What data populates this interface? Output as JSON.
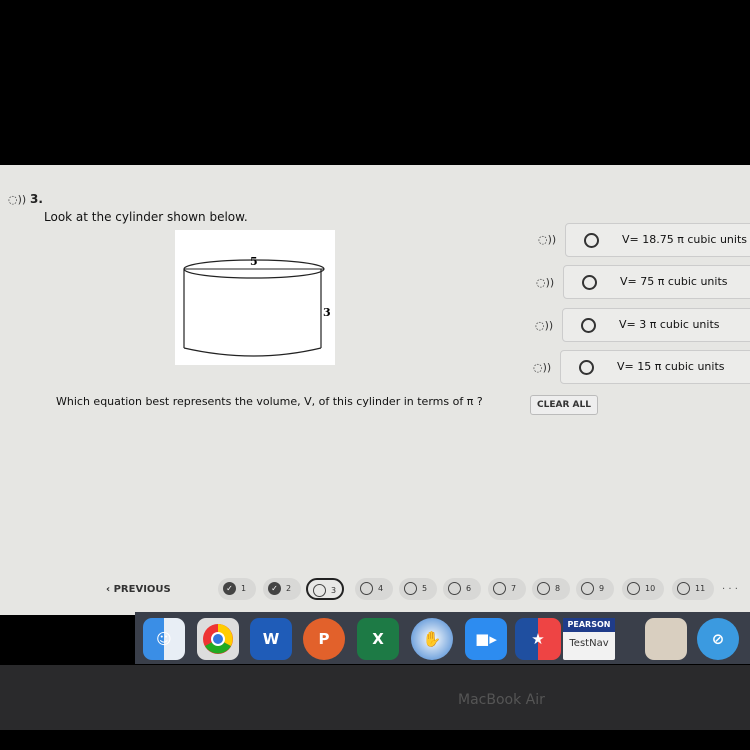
{
  "question": {
    "number": "3.",
    "prompt": "Look at the cylinder shown below.",
    "figure": {
      "diameter_label": "5",
      "height_label": "3"
    },
    "text": "Which equation best represents the volume, V, of this cylinder in terms of π ?"
  },
  "options": [
    {
      "label": "V= 18.75 π  cubic units"
    },
    {
      "label": "V= 75 π cubic units"
    },
    {
      "label": "V= 3 π cubic units"
    },
    {
      "label": "V= 15 π cubic units"
    }
  ],
  "clear_all": "CLEAR ALL",
  "nav": {
    "previous": "‹  PREVIOUS",
    "pages": [
      {
        "n": "1",
        "state": "answered"
      },
      {
        "n": "2",
        "state": "answered"
      },
      {
        "n": "3",
        "state": "current"
      },
      {
        "n": "4"
      },
      {
        "n": "5"
      },
      {
        "n": "6"
      },
      {
        "n": "7"
      },
      {
        "n": "8"
      },
      {
        "n": "9"
      },
      {
        "n": "10"
      },
      {
        "n": "11"
      }
    ],
    "more": "· · ·"
  },
  "dock": [
    {
      "name": "Finder"
    },
    {
      "name": "Chrome"
    },
    {
      "name": "Word",
      "letter": "W"
    },
    {
      "name": "PowerPoint",
      "letter": "P"
    },
    {
      "name": "Excel",
      "letter": "X"
    },
    {
      "name": "App"
    },
    {
      "name": "Zoom"
    },
    {
      "name": "Texas"
    },
    {
      "name": "TestNav",
      "top": "PEARSON",
      "bottom": "TestNav"
    },
    {
      "name": "Calendar"
    },
    {
      "name": "Safari"
    }
  ],
  "laptop": "MacBook Air"
}
